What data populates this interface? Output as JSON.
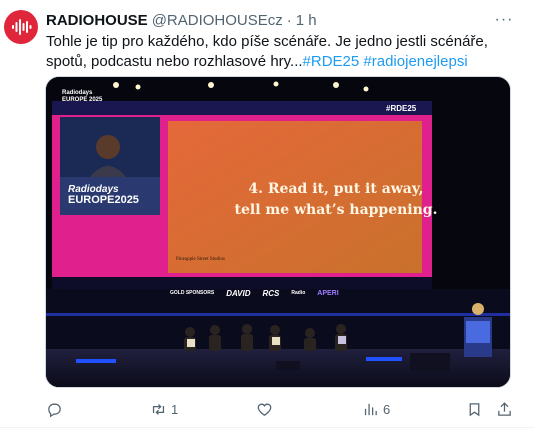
{
  "author": {
    "name": "RADIOHOUSE",
    "handle": "@RADIOHOUSEcz",
    "separator": "·",
    "time": "1 h"
  },
  "more_label": "···",
  "tweet": {
    "text": "Tohle je tip pro každého, kdo píše scénáře. Je jedno jestli scénáře, spotů, podcastu nebo rozhlasové hry...",
    "hashtags": "#RDE25 #radiojenejlepsi"
  },
  "media": {
    "slide_text_line1": "4. Read it, put it away,",
    "slide_text_line2": "tell me what’s happening.",
    "slide_credit": "Pineapple Street Studios",
    "screen_tag": "#RDE25",
    "top_logo_line1": "Radiodays",
    "top_logo_line2": "EUROPE 2025",
    "stage_logo_line1": "Radiodays",
    "stage_logo_line2": "EUROPE2025",
    "sponsors_label": "GOLD SPONSORS",
    "sponsor_1": "DAVID",
    "sponsor_2": "RCS",
    "sponsor_3": "Radio",
    "sponsor_4": "APERI"
  },
  "actions": {
    "reply": {
      "icon": "reply-icon",
      "count": ""
    },
    "repost": {
      "icon": "repost-icon",
      "count": "1"
    },
    "like": {
      "icon": "heart-icon",
      "count": ""
    },
    "views": {
      "icon": "views-icon",
      "count": "6"
    },
    "bookmark": {
      "icon": "bookmark-icon"
    },
    "share": {
      "icon": "share-icon"
    }
  },
  "colors": {
    "avatar_bg": "#e0263a",
    "link": "#1d9bf0",
    "muted": "#536471"
  }
}
